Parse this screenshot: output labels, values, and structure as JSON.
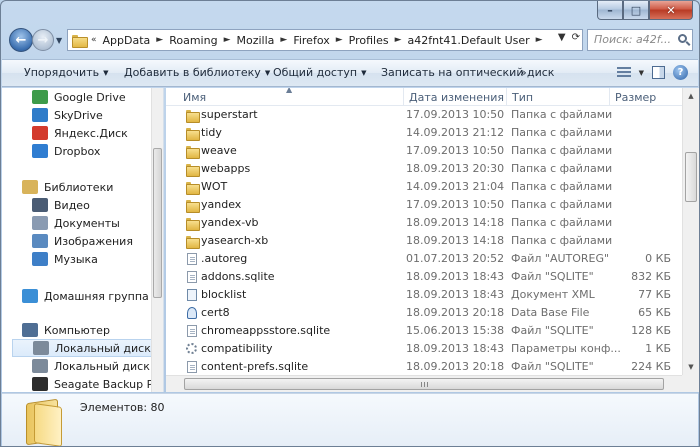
{
  "caption": {
    "minimize": "–",
    "maximize": "□",
    "close": "✕"
  },
  "address": {
    "crumbs": [
      "AppData",
      "Roaming",
      "Mozilla",
      "Firefox",
      "Profiles",
      "a42fnt41.Default User"
    ],
    "search_placeholder": "Поиск: a42f..."
  },
  "toolbar": {
    "organize": "Упорядочить",
    "add_to_library": "Добавить в библиотеку",
    "share": "Общий доступ",
    "burn": "Записать на оптический диск"
  },
  "sidebar": {
    "items": [
      {
        "label": "Google Drive",
        "icon": "google-drive-icon",
        "color": "#3d9b4a"
      },
      {
        "label": "SkyDrive",
        "icon": "skydrive-icon",
        "color": "#2f7cc9"
      },
      {
        "label": "Яндекс.Диск",
        "icon": "yandex-disk-icon",
        "color": "#d33a2c"
      },
      {
        "label": "Dropbox",
        "icon": "dropbox-icon",
        "color": "#2f7dd1"
      },
      {
        "label": "Библиотеки",
        "icon": "libraries-icon",
        "color": "#d8b35a"
      },
      {
        "label": "Видео",
        "icon": "video-icon",
        "color": "#4a5c74"
      },
      {
        "label": "Документы",
        "icon": "documents-icon",
        "color": "#8a9bb2"
      },
      {
        "label": "Изображения",
        "icon": "pictures-icon",
        "color": "#5a8ac0"
      },
      {
        "label": "Музыка",
        "icon": "music-icon",
        "color": "#3e7fc7"
      },
      {
        "label": "Домашняя группа",
        "icon": "homegroup-icon",
        "color": "#3b8fd6"
      },
      {
        "label": "Компьютер",
        "icon": "computer-icon",
        "color": "#4f6e94"
      },
      {
        "label": "Локальный диск (C:)",
        "icon": "drive-c-icon",
        "color": "#7c8a9a"
      },
      {
        "label": "Локальный диск (D:)",
        "icon": "drive-d-icon",
        "color": "#7c8a9a"
      },
      {
        "label": "Seagate Backup Plus D",
        "icon": "external-drive-icon",
        "color": "#2d2d2d"
      }
    ]
  },
  "columns": {
    "name": "Имя",
    "date": "Дата изменения",
    "type": "Тип",
    "size": "Размер"
  },
  "files": [
    {
      "name": "superstart",
      "date": "17.09.2013 10:50",
      "type": "Папка с файлами",
      "size": "",
      "kind": "folder"
    },
    {
      "name": "tidy",
      "date": "14.09.2013 21:12",
      "type": "Папка с файлами",
      "size": "",
      "kind": "folder"
    },
    {
      "name": "weave",
      "date": "17.09.2013 10:50",
      "type": "Папка с файлами",
      "size": "",
      "kind": "folder"
    },
    {
      "name": "webapps",
      "date": "18.09.2013 20:30",
      "type": "Папка с файлами",
      "size": "",
      "kind": "folder"
    },
    {
      "name": "WOT",
      "date": "14.09.2013 21:04",
      "type": "Папка с файлами",
      "size": "",
      "kind": "folder"
    },
    {
      "name": "yandex",
      "date": "17.09.2013 10:50",
      "type": "Папка с файлами",
      "size": "",
      "kind": "folder"
    },
    {
      "name": "yandex-vb",
      "date": "18.09.2013 14:18",
      "type": "Папка с файлами",
      "size": "",
      "kind": "folder"
    },
    {
      "name": "yasearch-xb",
      "date": "18.09.2013 14:18",
      "type": "Папка с файлами",
      "size": "",
      "kind": "folder"
    },
    {
      "name": ".autoreg",
      "date": "01.07.2013 20:52",
      "type": "Файл \"AUTOREG\"",
      "size": "0 КБ",
      "kind": "file"
    },
    {
      "name": "addons.sqlite",
      "date": "18.09.2013 18:43",
      "type": "Файл \"SQLITE\"",
      "size": "832 КБ",
      "kind": "file"
    },
    {
      "name": "blocklist",
      "date": "18.09.2013 18:43",
      "type": "Документ XML",
      "size": "77 КБ",
      "kind": "xml"
    },
    {
      "name": "cert8",
      "date": "18.09.2013 20:18",
      "type": "Data Base File",
      "size": "65 КБ",
      "kind": "cert"
    },
    {
      "name": "chromeappsstore.sqlite",
      "date": "15.06.2013 15:38",
      "type": "Файл \"SQLITE\"",
      "size": "128 КБ",
      "kind": "file"
    },
    {
      "name": "compatibility",
      "date": "18.09.2013 18:43",
      "type": "Параметры конф...",
      "size": "1 КБ",
      "kind": "gear"
    },
    {
      "name": "content-prefs.sqlite",
      "date": "18.09.2013 20:18",
      "type": "Файл \"SQLITE\"",
      "size": "224 КБ",
      "kind": "file"
    }
  ],
  "details": {
    "count": "Элементов: 80"
  }
}
